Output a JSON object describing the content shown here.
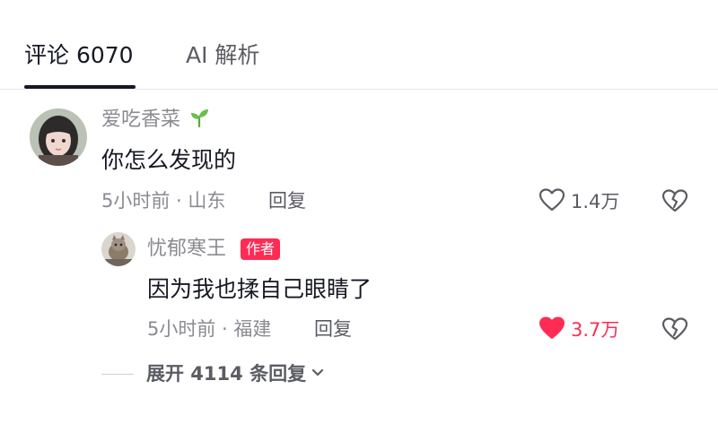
{
  "tabs": [
    {
      "label": "评论 6070",
      "active": true
    },
    {
      "label": "AI 解析",
      "active": false
    }
  ],
  "comment": {
    "username": "爱吃香菜",
    "username_icon": "sprout-icon",
    "text": "你怎么发现的",
    "time_location": "5小时前 · 山东",
    "reply_label": "回复",
    "like_count": "1.4万",
    "liked": false,
    "reply": {
      "username": "忧郁寒王",
      "badge": "作者",
      "text": "因为我也揉自己眼睛了",
      "time_location": "5小时前 · 福建",
      "reply_label": "回复",
      "like_count": "3.7万",
      "liked": true
    },
    "expand_label": "展开 4114 条回复"
  },
  "colors": {
    "accent": "#fe2c55",
    "text_primary": "#161823",
    "text_secondary": "#8a8b91"
  }
}
